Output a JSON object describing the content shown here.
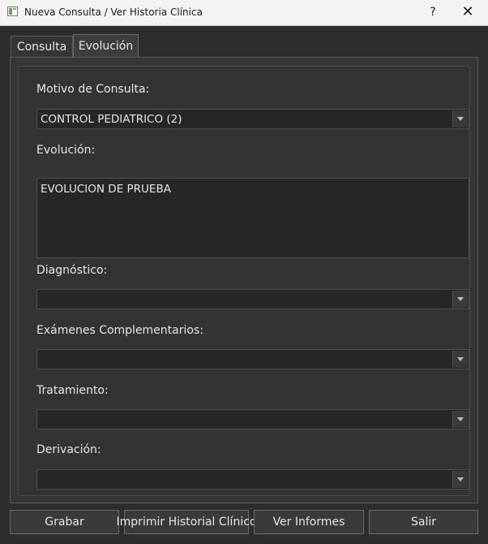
{
  "window": {
    "title": "Nueva Consulta / Ver Historia Clínica",
    "help": "?",
    "close": "✕"
  },
  "tabs": [
    {
      "label": "Consulta"
    },
    {
      "label": "Evolución",
      "active": true
    }
  ],
  "form": {
    "motivo": {
      "label": "Motivo de Consulta:",
      "value": "CONTROL PEDIATRICO (2)"
    },
    "evolucion": {
      "label": "Evolución:",
      "value": "EVOLUCION DE PRUEBA"
    },
    "diagnostico": {
      "label": "Diagnóstico:",
      "value": ""
    },
    "examenes": {
      "label": "Exámenes Complementarios:",
      "value": ""
    },
    "tratamiento": {
      "label": "Tratamiento:",
      "value": ""
    },
    "derivacion": {
      "label": "Derivación:",
      "value": ""
    }
  },
  "buttons": {
    "grabar": "Grabar",
    "imprimir": "Imprimir Historial Clínico",
    "informes": "Ver Informes",
    "salir": "Salir"
  },
  "colors": {
    "background": "#2d2d2d",
    "titlebar": "#f3f3f3",
    "field": "#262626"
  }
}
